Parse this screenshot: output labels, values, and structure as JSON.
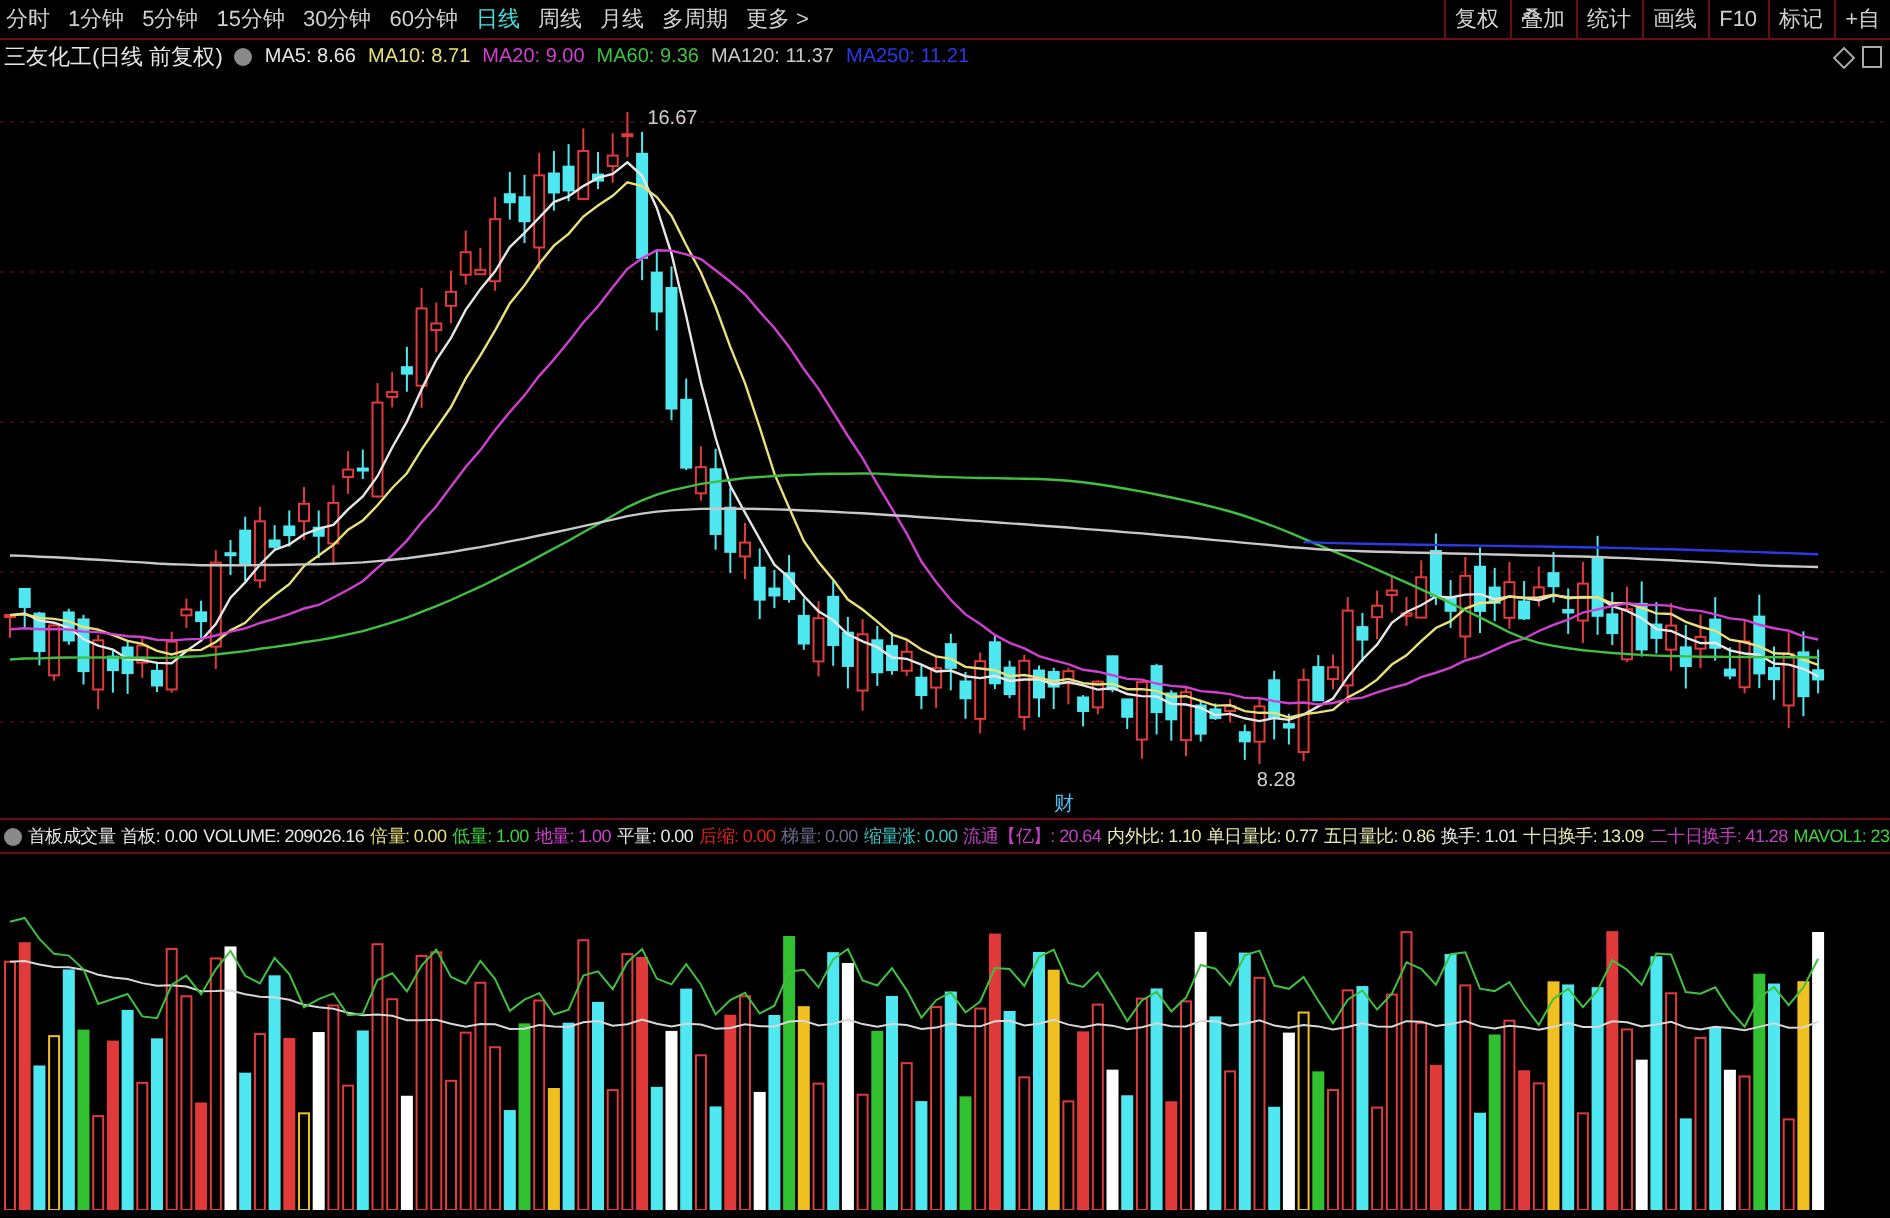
{
  "toolbar": {
    "periods": [
      {
        "label": "分时",
        "selected": false
      },
      {
        "label": "1分钟",
        "selected": false
      },
      {
        "label": "5分钟",
        "selected": false
      },
      {
        "label": "15分钟",
        "selected": false
      },
      {
        "label": "30分钟",
        "selected": false
      },
      {
        "label": "60分钟",
        "selected": false
      },
      {
        "label": "日线",
        "selected": true
      },
      {
        "label": "周线",
        "selected": false
      },
      {
        "label": "月线",
        "selected": false
      },
      {
        "label": "多周期",
        "selected": false
      },
      {
        "label": "更多 >",
        "selected": false
      }
    ],
    "buttons": [
      "复权",
      "叠加",
      "统计",
      "画线",
      "F10",
      "标记",
      "+自"
    ]
  },
  "chart": {
    "title": "三友化工(日线 前复权)",
    "moving_averages": [
      {
        "label": "MA5: 8.66",
        "color": "#e6e6e6"
      },
      {
        "label": "MA10: 8.71",
        "color": "#e8e07a"
      },
      {
        "label": "MA20: 9.00",
        "color": "#d040d0"
      },
      {
        "label": "MA60: 9.36",
        "color": "#40c040"
      },
      {
        "label": "MA120: 11.37",
        "color": "#c8c8c8"
      },
      {
        "label": "MA250: 11.21",
        "color": "#2a3ae8"
      }
    ],
    "high_label": "16.67",
    "low_label": "8.28",
    "marker": "财"
  },
  "indicator": {
    "name": "首板成交量",
    "items": [
      {
        "label": "首板: 0.00",
        "color": "#e6e6e6"
      },
      {
        "label": "VOLUME: 209026.16",
        "color": "#e6e6e6"
      },
      {
        "label": "倍量: 0.00",
        "color": "#e8e07a"
      },
      {
        "label": "低量: 1.00",
        "color": "#40d040"
      },
      {
        "label": "地量: 1.00",
        "color": "#d040d0"
      },
      {
        "label": "平量: 0.00",
        "color": "#e6e6e6"
      },
      {
        "label": "后缩: 0.00",
        "color": "#e02020"
      },
      {
        "label": "梯量: 0.00",
        "color": "#6a6a8a"
      },
      {
        "label": "缩量涨: 0.00",
        "color": "#40c0c0"
      },
      {
        "label": "流通【亿】: 20.64",
        "color": "#c040c0"
      },
      {
        "label": "内外比: 1.10",
        "color": "#e8e8b0"
      },
      {
        "label": "单日量比: 0.77",
        "color": "#e8e8b0"
      },
      {
        "label": "五日量比: 0.86",
        "color": "#e8e8b0"
      },
      {
        "label": "换手: 1.01",
        "color": "#e6e6e6"
      },
      {
        "label": "十日换手: 13.09",
        "color": "#e8e8b0"
      },
      {
        "label": "二十日换手: 41.28",
        "color": "#c040c0"
      },
      {
        "label": "MAVOL1: 23",
        "color": "#40d040"
      }
    ]
  }
}
